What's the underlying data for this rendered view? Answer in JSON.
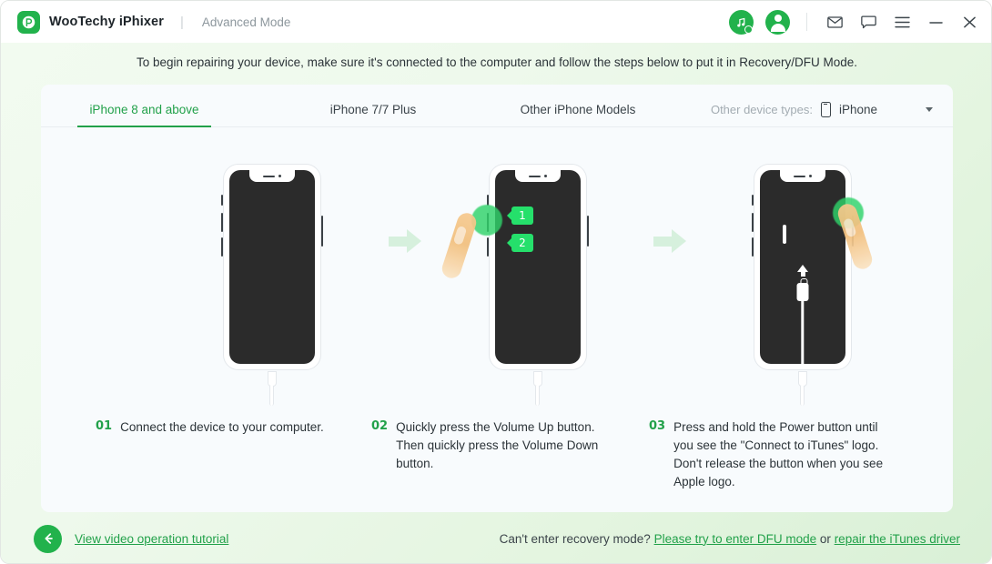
{
  "titlebar": {
    "brand_initial": "℗",
    "brand_name": "WooTechy iPhixer",
    "separator": "|",
    "mode": "Advanced Mode",
    "icons": {
      "music_search": "music-search-icon",
      "account": "account-icon",
      "mail": "mail-icon",
      "feedback": "chat-icon",
      "menu": "hamburger-menu-icon",
      "minimize": "minimize-icon",
      "close": "close-icon"
    }
  },
  "banner": {
    "text": "To begin repairing your device, make sure it's connected to the computer and follow the steps below to put it in Recovery/DFU Mode."
  },
  "tabs": [
    {
      "label": "iPhone 8 and above",
      "active": true
    },
    {
      "label": "iPhone 7/7 Plus",
      "active": false
    },
    {
      "label": "Other iPhone Models",
      "active": false
    }
  ],
  "device_select": {
    "label": "Other device types:",
    "value": "iPhone",
    "icon": "phone-icon",
    "caret": "chevron-down-icon"
  },
  "steps": [
    {
      "number": "01",
      "text": "Connect the device to your computer."
    },
    {
      "number": "02",
      "text": "Quickly press the Volume Up button. Then quickly press the Volume Down button.",
      "badges": [
        "1",
        "2"
      ]
    },
    {
      "number": "03",
      "text": "Press and hold the Power button until you see the \"Connect to iTunes\" logo. Don't release the button when you see Apple logo."
    }
  ],
  "footer": {
    "back_icon": "back-arrow-icon",
    "tutorial_link": "View video operation tutorial",
    "question": "Can't enter recovery mode?",
    "dfu_link": "Please try to enter DFU mode",
    "conjunction": "or",
    "itunes_link": "repair the iTunes driver"
  },
  "colors": {
    "accent_green": "#22b24c",
    "link_green": "#22a14a",
    "badge_green": "#25e06b",
    "screen_dark": "#2b2b2b",
    "card_bg": "#f8fbfd"
  }
}
